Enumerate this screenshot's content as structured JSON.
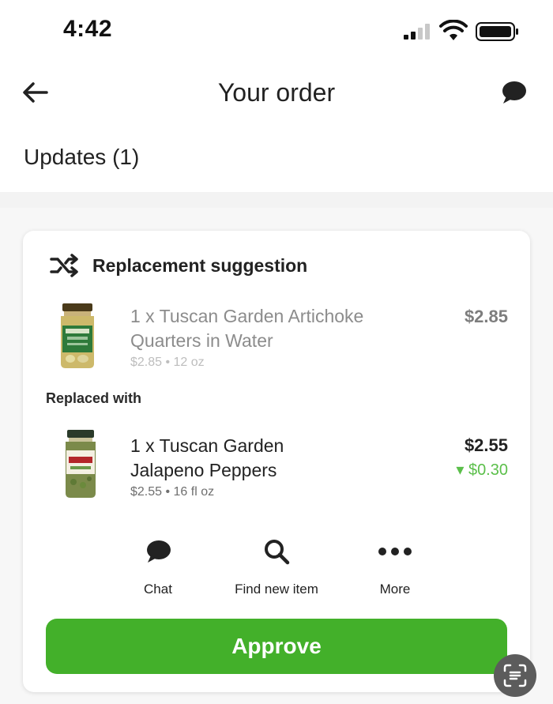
{
  "status_bar": {
    "time": "4:42"
  },
  "nav": {
    "title": "Your order",
    "back_icon": "arrow-left-icon",
    "chat_icon": "chat-bubble-icon"
  },
  "updates": {
    "label": "Updates (1)"
  },
  "card": {
    "title": "Replacement suggestion",
    "title_icon": "shuffle-icon",
    "original_item": {
      "name": "1 x Tuscan Garden Artichoke Quarters in Water",
      "meta": "$2.85 • 12 oz",
      "price": "$2.85"
    },
    "replaced_with_label": "Replaced with",
    "replacement_item": {
      "name": "1 x Tuscan Garden Jalapeno Peppers",
      "meta": "$2.55 • 16 fl oz",
      "price": "$2.55",
      "price_delta": "▾ $0.30"
    },
    "actions": [
      {
        "label": "Chat",
        "icon": "chat-bubble-icon"
      },
      {
        "label": "Find new item",
        "icon": "search-icon"
      },
      {
        "label": "More",
        "icon": "more-dots-icon"
      }
    ],
    "approve_label": "Approve"
  },
  "colors": {
    "accent_green": "#43b02a",
    "delta_green": "#5bbf4a"
  }
}
